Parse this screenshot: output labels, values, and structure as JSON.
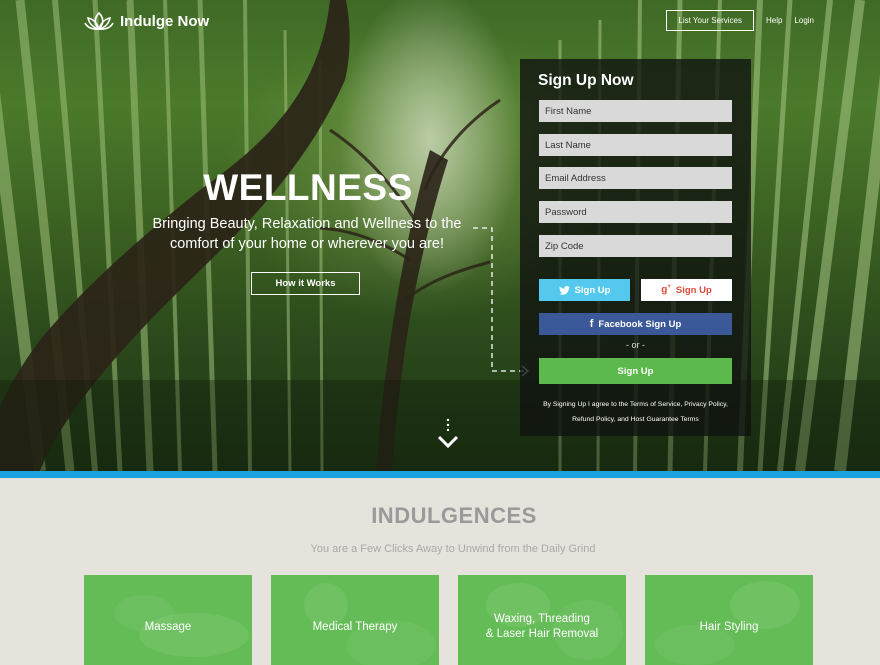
{
  "brand": {
    "name": "Indulge Now",
    "logo_icon": "lotus-icon"
  },
  "nav": {
    "list_services": "List Your Services",
    "help": "Help",
    "login": "Login"
  },
  "hero": {
    "title": "WELLNESS",
    "subtitle": "Bringing Beauty, Relaxation and Wellness to the comfort of your home or wherever you are!",
    "how_button": "How it Works",
    "scroll_icon": "chevron-down-icon"
  },
  "signup": {
    "title": "Sign Up Now",
    "first_name_placeholder": "First Name",
    "last_name_placeholder": "Last Name",
    "email_placeholder": "Email Address",
    "password_placeholder": "Password",
    "zip_placeholder": "Zip Code",
    "twitter_label": "Sign Up",
    "google_label": "Sign Up",
    "facebook_label": "Facebook Sign Up",
    "or_text": "- or -",
    "submit_label": "Sign Up",
    "terms": "By Signing Up I agree to the Terms of Service, Privacy Policy, Refund Policy, and Host Guarantee Terms"
  },
  "indulgences": {
    "title": "INDULGENCES",
    "subtitle": "You are a Few Clicks Away to Unwind from the Daily Grind",
    "cards": [
      {
        "label": "Massage"
      },
      {
        "label": "Medical Therapy"
      },
      {
        "label": "Waxing, Threading\n& Laser Hair Removal"
      },
      {
        "label": "Hair Styling"
      }
    ]
  },
  "colors": {
    "accent_blue": "#1ba3e0",
    "green": "#5cb94b",
    "twitter": "#55c9ed",
    "facebook": "#3b5998",
    "google": "#dd4b39"
  }
}
